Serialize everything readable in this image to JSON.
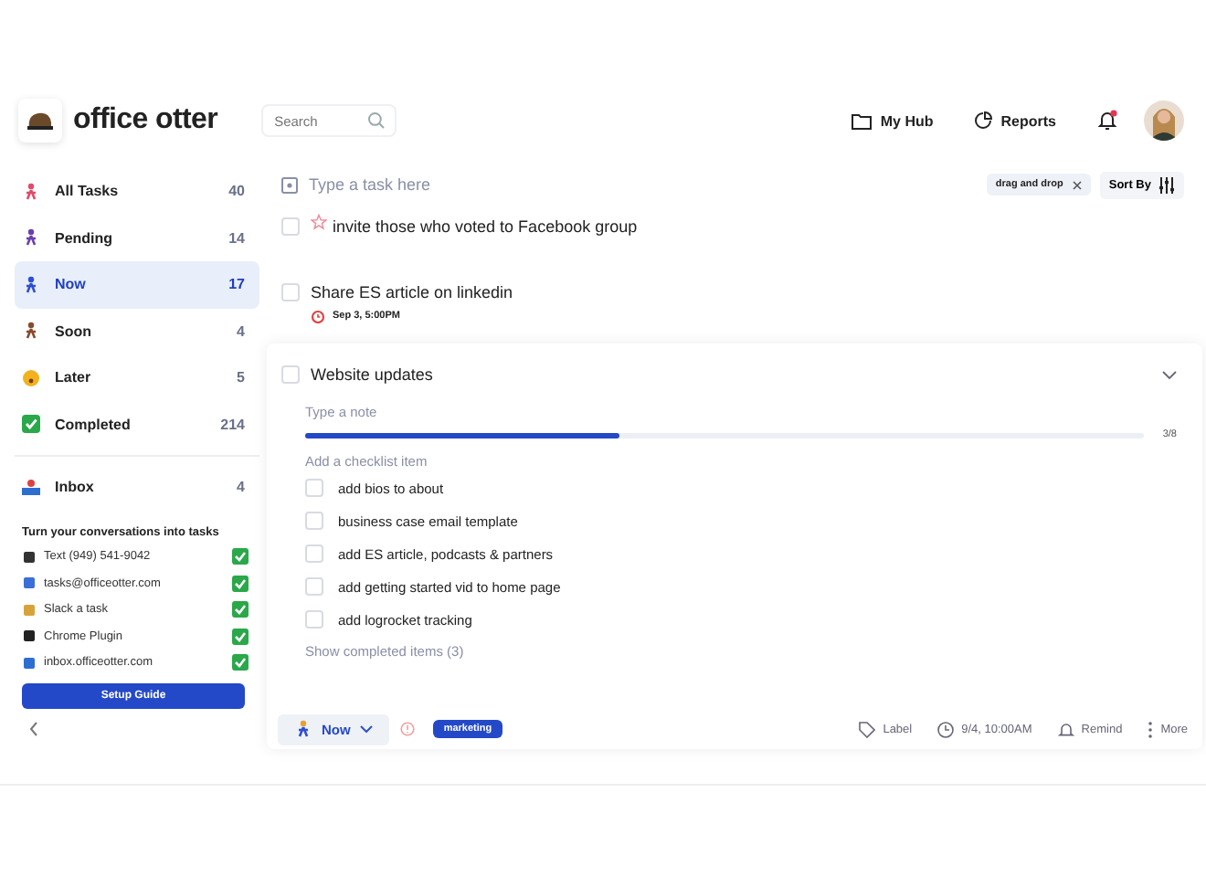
{
  "app": {
    "logo_text": "office otter"
  },
  "search": {
    "placeholder": "Search"
  },
  "nav": [
    {
      "kind": "hub",
      "label": "My Hub"
    },
    {
      "kind": "reports",
      "label": "Reports"
    }
  ],
  "notifications": {
    "unread": true
  },
  "sidebar": {
    "items": [
      {
        "label": "All Tasks",
        "count": "40",
        "selected": false
      },
      {
        "label": "Pending",
        "count": "14",
        "selected": false
      },
      {
        "label": "Now",
        "count": "17",
        "selected": true
      },
      {
        "label": "Soon",
        "count": "4",
        "selected": false
      },
      {
        "label": "Later",
        "count": "5",
        "selected": false
      },
      {
        "label": "Completed",
        "count": "214",
        "selected": false
      }
    ],
    "inbox": {
      "label": "Inbox",
      "count": "4"
    },
    "integrations_title": "Turn your conversations into tasks",
    "integrations": [
      {
        "label": "Text (949) 541-9042",
        "checked": true
      },
      {
        "label": "tasks@officeotter.com",
        "checked": true
      },
      {
        "label": "Slack a task",
        "checked": true
      },
      {
        "label": "Chrome Plugin",
        "checked": true
      },
      {
        "label": "inbox.officeotter.com",
        "checked": true
      }
    ],
    "setup_button": "Setup Guide"
  },
  "main": {
    "new_task": {
      "placeholder": "Type a task here"
    },
    "filter_chip": {
      "label": "drag and drop"
    },
    "sort_button": "Sort By",
    "tasks": [
      {
        "title": "invite those who voted to Facebook group",
        "checked": false,
        "starred": true
      },
      {
        "title": "Share ES article on linkedin",
        "checked": false,
        "starred": false,
        "due": "Sep 3, 5:00PM"
      }
    ],
    "expanded_task": {
      "title": "Website updates",
      "checked": false,
      "expanded": true,
      "note_placeholder": "Type a note",
      "progress": {
        "level": 0.375,
        "reading": "3/8"
      },
      "checklist_placeholder": "Add a checklist item",
      "checklist": [
        {
          "label": "add bios to about",
          "checked": false
        },
        {
          "label": "business case email template",
          "checked": false
        },
        {
          "label": "add ES article, podcasts & partners",
          "checked": false
        },
        {
          "label": "add getting started vid to home page",
          "checked": false
        },
        {
          "label": "add logrocket tracking",
          "checked": false
        }
      ],
      "show_completed": "Show completed items (3)",
      "status": "Now",
      "tag": "marketing",
      "actions": [
        {
          "kind": "label",
          "label": "Label"
        },
        {
          "kind": "time",
          "label": "9/4, 10:00AM"
        },
        {
          "kind": "remind",
          "label": "Remind"
        },
        {
          "kind": "more",
          "label": "More"
        }
      ]
    }
  }
}
